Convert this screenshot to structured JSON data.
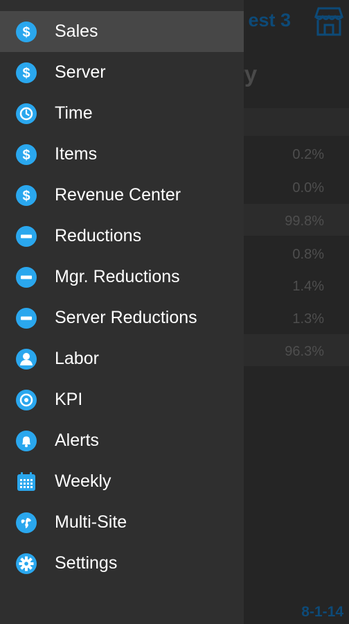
{
  "background": {
    "title": "est 3",
    "heading": "ry",
    "rows": [
      {
        "value": "0.2%",
        "shaded": false
      },
      {
        "value": "0.0%",
        "shaded": false
      },
      {
        "value": "99.8%",
        "shaded": true
      },
      {
        "value": "0.8%",
        "shaded": false
      },
      {
        "value": "1.4%",
        "shaded": false
      },
      {
        "value": "1.3%",
        "shaded": false
      },
      {
        "value": "96.3%",
        "shaded": true
      }
    ],
    "date": "8-1-14"
  },
  "menu": {
    "items": [
      {
        "label": "Sales",
        "icon": "dollar-icon",
        "active": true
      },
      {
        "label": "Server",
        "icon": "dollar-icon",
        "active": false
      },
      {
        "label": "Time",
        "icon": "clock-icon",
        "active": false
      },
      {
        "label": "Items",
        "icon": "dollar-icon",
        "active": false
      },
      {
        "label": "Revenue Center",
        "icon": "dollar-icon",
        "active": false
      },
      {
        "label": "Reductions",
        "icon": "minus-icon",
        "active": false
      },
      {
        "label": "Mgr. Reductions",
        "icon": "minus-icon",
        "active": false
      },
      {
        "label": "Server Reductions",
        "icon": "minus-icon",
        "active": false
      },
      {
        "label": "Labor",
        "icon": "person-icon",
        "active": false
      },
      {
        "label": "KPI",
        "icon": "target-icon",
        "active": false
      },
      {
        "label": "Alerts",
        "icon": "bell-icon",
        "active": false
      },
      {
        "label": "Weekly",
        "icon": "calendar-icon",
        "active": false
      },
      {
        "label": "Multi-Site",
        "icon": "globe-icon",
        "active": false
      },
      {
        "label": "Settings",
        "icon": "gear-icon",
        "active": false
      }
    ]
  },
  "colors": {
    "accent": "#2aa7ee",
    "drawer_bg": "#2f2f2f",
    "active_bg": "#474747",
    "background_title": "#0d4a78"
  }
}
